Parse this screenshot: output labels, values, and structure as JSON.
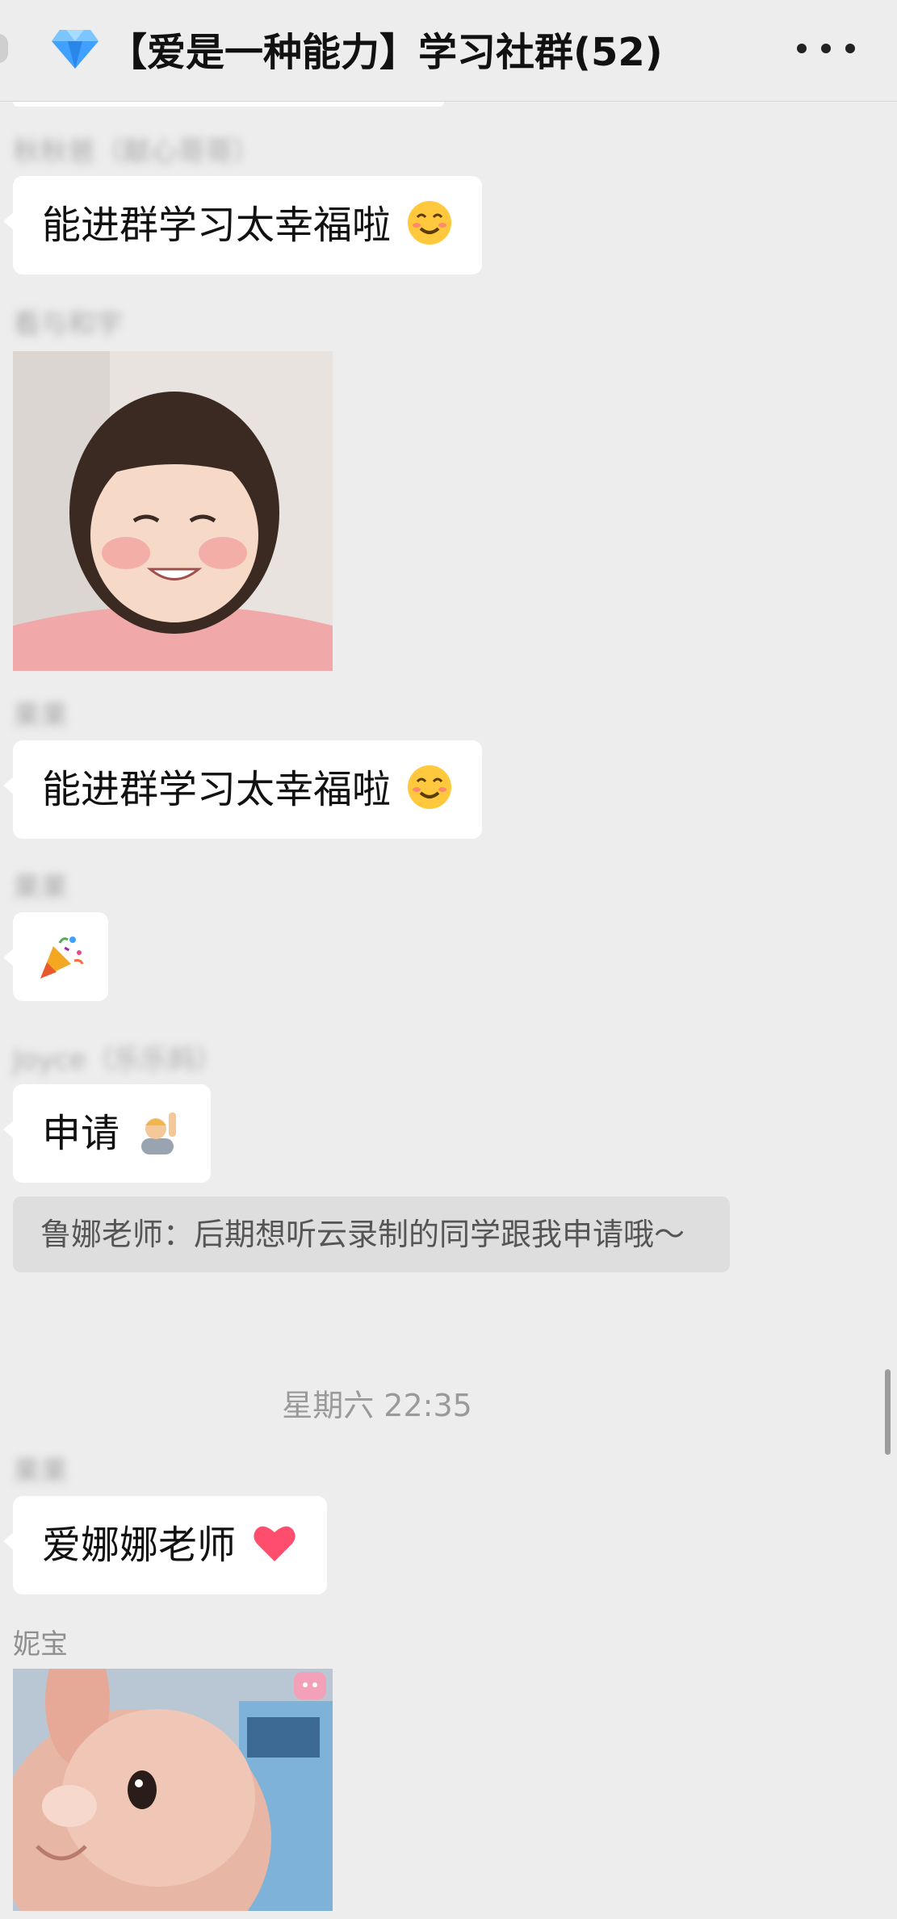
{
  "header": {
    "title": "【爱是一种能力】学习社群(52)",
    "gem_icon": "gem-icon",
    "more_icon": "more-icon"
  },
  "messages": [
    {
      "sender": "秋秋爸（献心哥哥）",
      "text": "能进群学习太幸福啦"
    },
    {
      "sender": "看与和宇",
      "image": "child-photo"
    },
    {
      "sender": "果果",
      "text": "能进群学习太幸福啦"
    },
    {
      "sender": "果果",
      "emoji": "party-popper-icon"
    },
    {
      "sender": "Joyce（乐乐妈）",
      "text": "申请"
    },
    {
      "sender": "果果",
      "text": "爱娜娜老师"
    },
    {
      "sender": "妮宝",
      "image": "bunny-photo"
    }
  ],
  "quote": {
    "text": "鲁娜老师：后期想听云录制的同学跟我申请哦～"
  },
  "time_divider": "星期六 22:35",
  "colors": {
    "background": "#ededed",
    "bubble": "#ffffff",
    "quote_bg": "#dedede",
    "heart": "#ff4d6d",
    "emoji_face": "#ffc83d"
  }
}
